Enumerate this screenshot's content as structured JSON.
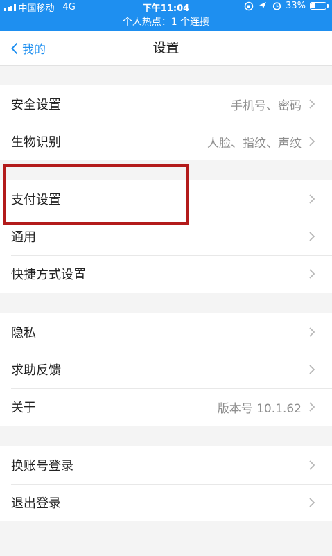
{
  "status_bar": {
    "carrier": "中国移动",
    "network": "4G",
    "time": "下午11:04",
    "battery_percent": "33%",
    "battery_level": 0.33,
    "hotspot_text": "个人热点：1 个连接"
  },
  "nav": {
    "back_label": "我的",
    "title": "设置"
  },
  "groups": [
    {
      "items": [
        {
          "label": "安全设置",
          "value": "手机号、密码"
        },
        {
          "label": "生物识别",
          "value": "人脸、指纹、声纹"
        }
      ]
    },
    {
      "items": [
        {
          "label": "支付设置",
          "value": ""
        },
        {
          "label": "通用",
          "value": ""
        },
        {
          "label": "快捷方式设置",
          "value": ""
        }
      ]
    },
    {
      "items": [
        {
          "label": "隐私",
          "value": ""
        },
        {
          "label": "求助反馈",
          "value": ""
        },
        {
          "label": "关于",
          "value": "版本号 10.1.62"
        }
      ]
    },
    {
      "items": [
        {
          "label": "换账号登录",
          "value": ""
        },
        {
          "label": "退出登录",
          "value": ""
        }
      ]
    }
  ],
  "colors": {
    "accent": "#1e8ff0",
    "highlight_box": "#b31b1b"
  }
}
